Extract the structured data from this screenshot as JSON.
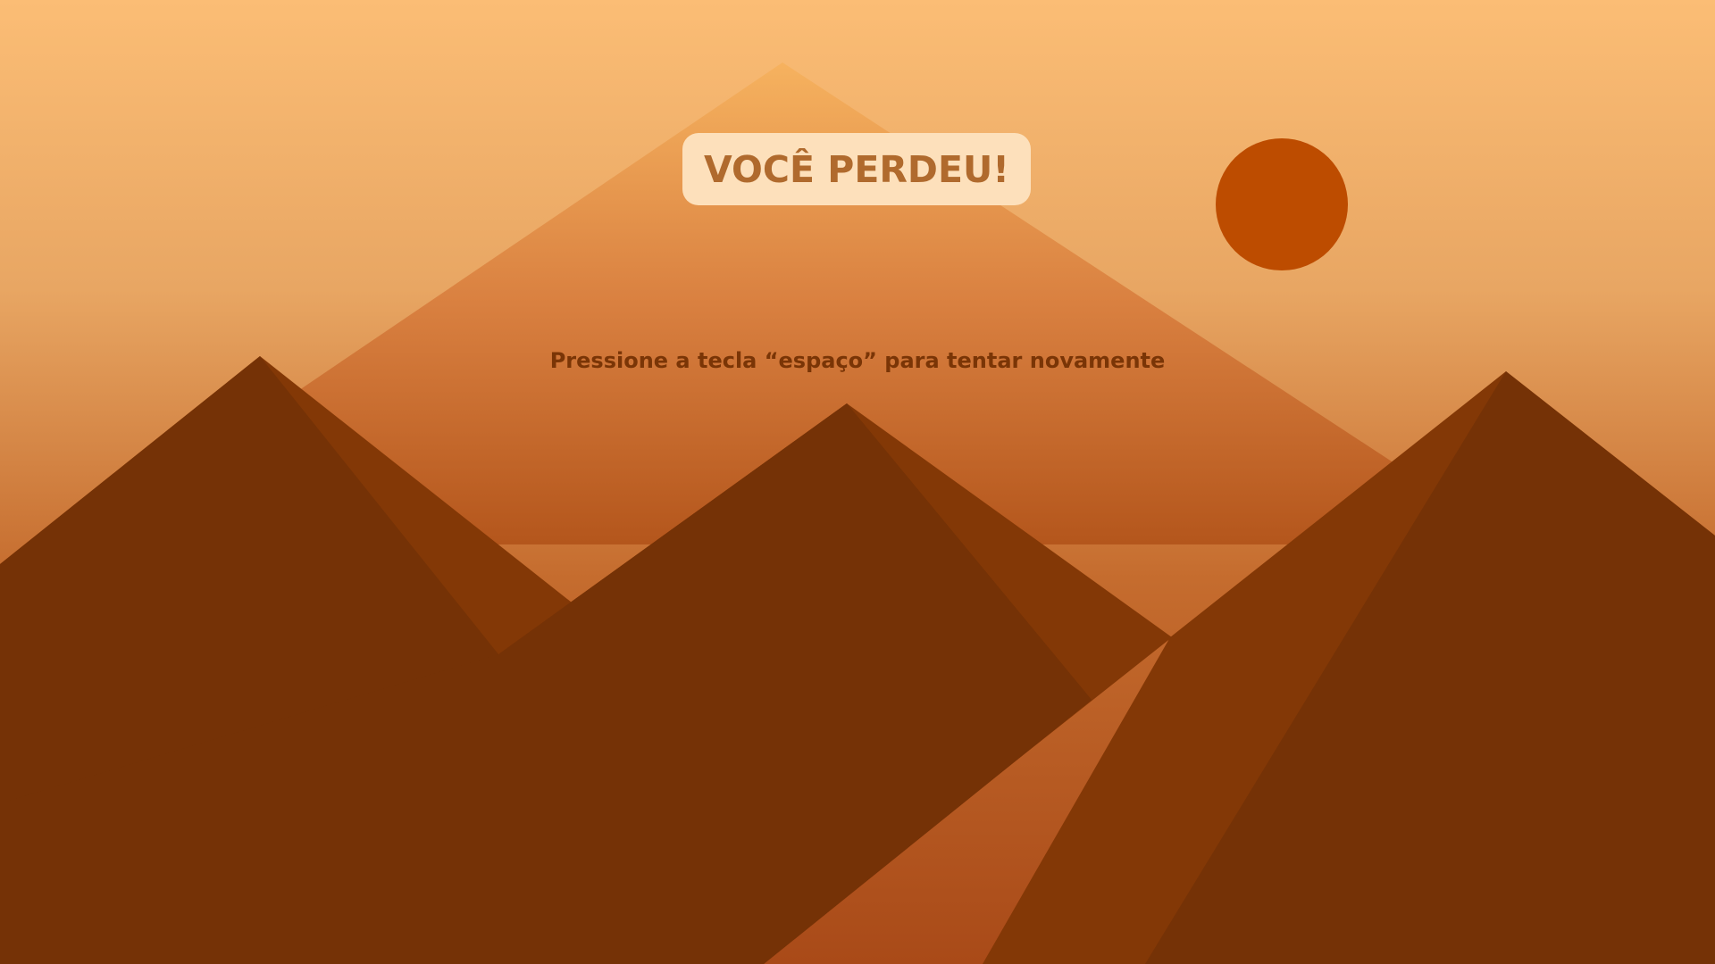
{
  "game": {
    "title": "VOCÊ PERDEU!",
    "prompt": "Pressione a tecla “espaço” para tentar novamente"
  },
  "colors": {
    "sky_top": "#fbbd75",
    "sky_bottom": "#b95a22",
    "far_mountain": "#f0a55a",
    "mountain_dark": "#753206",
    "mountain_mid": "#833806",
    "sun": "#bd4c00",
    "title_box": "#fde0bb",
    "title_text": "#b06a2d",
    "prompt_text": "#7a3506"
  }
}
